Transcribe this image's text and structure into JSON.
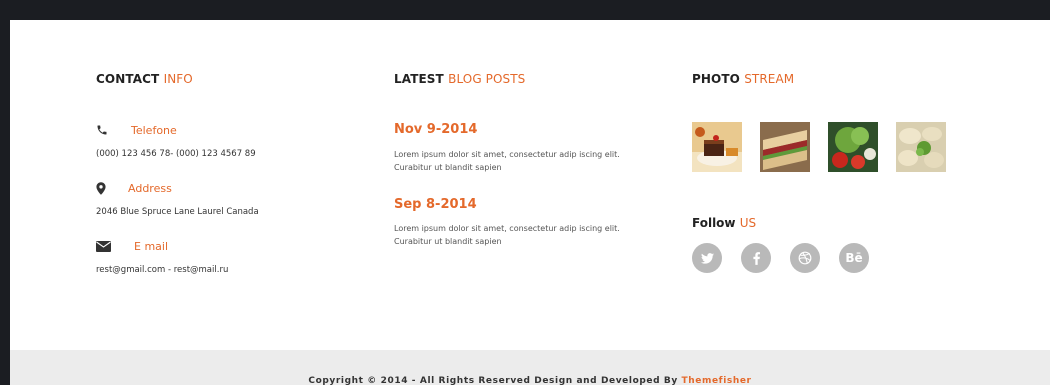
{
  "contact": {
    "title_main": "CONTACT",
    "title_accent": "INFO",
    "phone": {
      "label": "Telefone",
      "value": "(000) 123 456 78- (000) 123 4567 89",
      "icon": "phone-icon"
    },
    "address": {
      "label": "Address",
      "value": "2046 Blue Spruce Lane Laurel Canada",
      "icon": "map-marker-icon"
    },
    "email": {
      "label": "E mail",
      "value": "rest@gmail.com - rest@mail.ru",
      "icon": "envelope-icon"
    }
  },
  "blog": {
    "title_main": "LATEST",
    "title_accent": "BLOG POSTS",
    "posts": [
      {
        "date": "Nov 9-2014",
        "line1": "Lorem ipsum dolor sit amet, consectetur adip iscing elit.",
        "line2": "Curabitur ut blandit sapien"
      },
      {
        "date": "Sep 8-2014",
        "line1": "Lorem ipsum dolor sit amet, consectetur adip iscing elit.",
        "line2": "Curabitur ut blandit sapien"
      }
    ]
  },
  "photos": {
    "title_main": "PHOTO",
    "title_accent": "STREAM",
    "items": [
      "dessert-photo",
      "sandwich-photo",
      "vegetables-photo",
      "dumplings-photo"
    ]
  },
  "follow": {
    "title_main": "Follow",
    "title_accent": "US",
    "networks": [
      "twitter-icon",
      "facebook-icon",
      "dribbble-icon",
      "behance-icon"
    ],
    "behance_text": "Bē"
  },
  "footer": {
    "copyright": "Copyright © 2014 - All Rights Reserved Design and Developed By",
    "brand": "Themefisher"
  },
  "colors": {
    "accent": "#e4692b",
    "social": "#b9b9b9",
    "footer_bg": "#ececec"
  }
}
